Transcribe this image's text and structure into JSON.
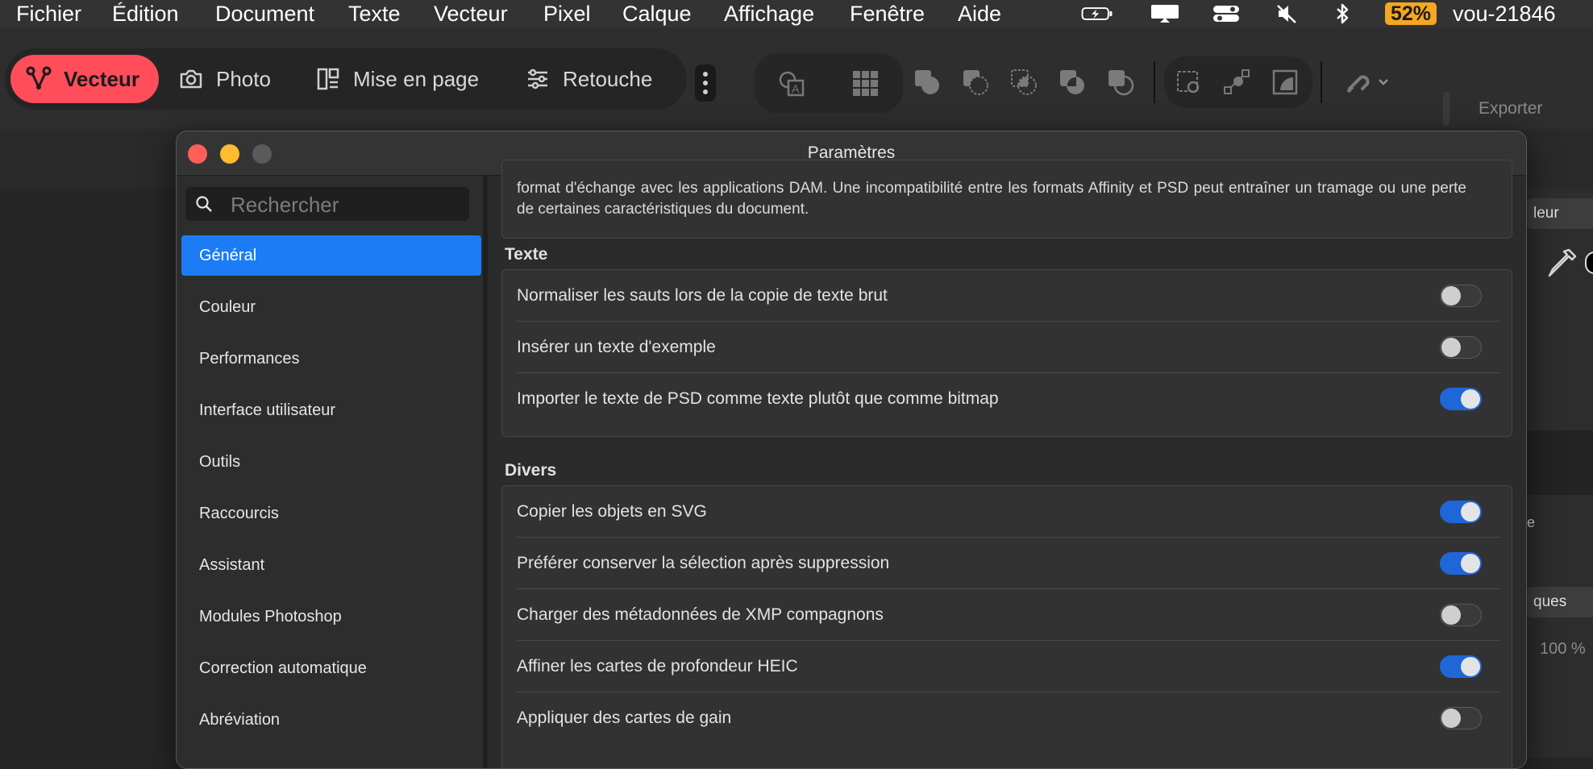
{
  "menubar": {
    "menus": [
      "Fichier",
      "Édition",
      "Document",
      "Texte",
      "Vecteur",
      "Pixel",
      "Calque",
      "Affichage",
      "Fenêtre",
      "Aide"
    ],
    "battery_percent": "52%",
    "user": "vou-21846"
  },
  "toolbar": {
    "personas": [
      {
        "label": "Vecteur",
        "icon": "vector-persona-icon",
        "active": true
      },
      {
        "label": "Photo",
        "icon": "camera-icon",
        "active": false
      },
      {
        "label": "Mise en page",
        "icon": "layout-icon",
        "active": false
      },
      {
        "label": "Retouche",
        "icon": "sliders-icon",
        "active": false
      }
    ],
    "export_label": "Exporter"
  },
  "right_panel": {
    "color_tab": "leur",
    "button_label": "ques",
    "opacity_text": "100 %",
    "fragment_text": "e"
  },
  "dialog": {
    "title": "Paramètres",
    "search_placeholder": "Rechercher",
    "sidebar_items": [
      {
        "label": "Général",
        "active": true
      },
      {
        "label": "Couleur",
        "active": false
      },
      {
        "label": "Performances",
        "active": false
      },
      {
        "label": "Interface utilisateur",
        "active": false
      },
      {
        "label": "Outils",
        "active": false
      },
      {
        "label": "Raccourcis",
        "active": false
      },
      {
        "label": "Assistant",
        "active": false
      },
      {
        "label": "Modules Photoshop",
        "active": false
      },
      {
        "label": "Correction automatique",
        "active": false
      },
      {
        "label": "Abréviation",
        "active": false
      }
    ],
    "description_text": "format d'échange avec les applications DAM. Une incompatibilité entre les formats Affinity et PSD peut entraîner un tramage ou une perte de certaines caractéristiques du document.",
    "sections": [
      {
        "title": "Texte",
        "options": [
          {
            "label": "Normaliser les sauts lors de la copie de texte brut",
            "enabled": false
          },
          {
            "label": "Insérer un texte d'exemple",
            "enabled": false
          },
          {
            "label": "Importer le texte de PSD comme texte plutôt que comme bitmap",
            "enabled": true
          }
        ]
      },
      {
        "title": "Divers",
        "options": [
          {
            "label": "Copier les objets en SVG",
            "enabled": true
          },
          {
            "label": "Préférer conserver la sélection après suppression",
            "enabled": true
          },
          {
            "label": "Charger des métadonnées de XMP compagnons",
            "enabled": false
          },
          {
            "label": "Affiner les cartes de profondeur HEIC",
            "enabled": true
          },
          {
            "label": "Appliquer des cartes de gain",
            "enabled": false
          }
        ]
      }
    ]
  },
  "colors": {
    "accent_blue": "#1b7cf5",
    "toggle_on": "#1f67d9",
    "persona_active": "#ff4d5a",
    "battery": "#f5a623"
  }
}
